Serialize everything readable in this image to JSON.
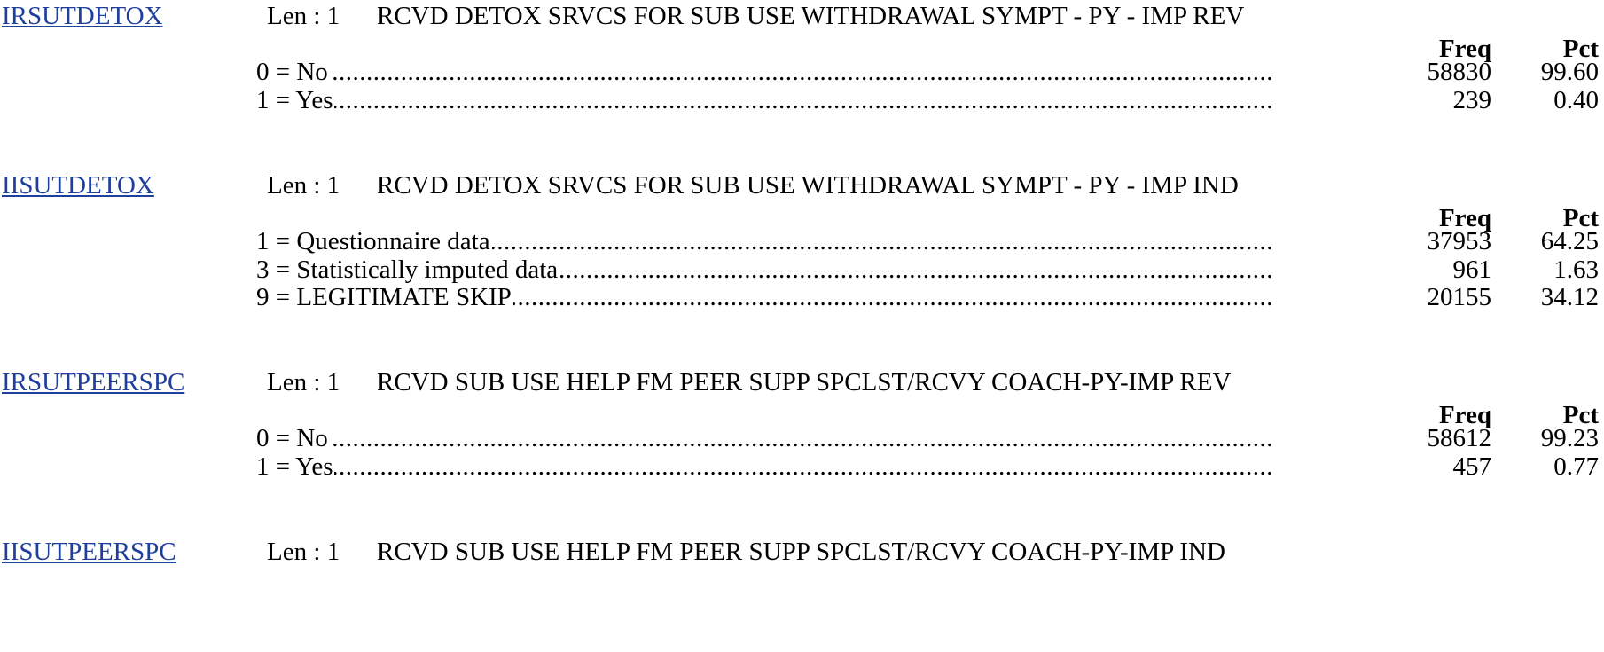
{
  "colors": {
    "link": "#1f3f9f",
    "text": "#000000",
    "background": "#ffffff"
  },
  "columns": {
    "freq": "Freq",
    "pct": "Pct"
  },
  "variables": [
    {
      "name": "IRSUTDETOX",
      "len": "Len : 1",
      "label": "RCVD DETOX SRVCS FOR SUB USE WITHDRAWAL SYMPT - PY - IMP REV",
      "show_columns": true,
      "rows": [
        {
          "category": "0 = No",
          "freq": "58830",
          "pct": "99.60"
        },
        {
          "category": "1 = Yes",
          "freq": "239",
          "pct": "0.40"
        }
      ]
    },
    {
      "name": "IISUTDETOX",
      "len": "Len : 1",
      "label": "RCVD DETOX SRVCS FOR SUB USE WITHDRAWAL SYMPT - PY - IMP IND",
      "show_columns": true,
      "rows": [
        {
          "category": "1 = Questionnaire data",
          "freq": "37953",
          "pct": "64.25"
        },
        {
          "category": "3 = Statistically imputed data",
          "freq": "961",
          "pct": "1.63"
        },
        {
          "category": "9 = LEGITIMATE SKIP",
          "freq": "20155",
          "pct": "34.12"
        }
      ]
    },
    {
      "name": "IRSUTPEERSPC",
      "len": "Len : 1",
      "label": "RCVD SUB USE HELP FM PEER SUPP SPCLST/RCVY COACH-PY-IMP REV",
      "show_columns": true,
      "rows": [
        {
          "category": "0 = No",
          "freq": "58612",
          "pct": "99.23"
        },
        {
          "category": "1 = Yes",
          "freq": "457",
          "pct": "0.77"
        }
      ]
    },
    {
      "name": "IISUTPEERSPC",
      "len": "Len : 1",
      "label": "RCVD SUB USE HELP FM PEER SUPP SPCLST/RCVY COACH-PY-IMP IND",
      "show_columns": false,
      "rows": []
    }
  ]
}
